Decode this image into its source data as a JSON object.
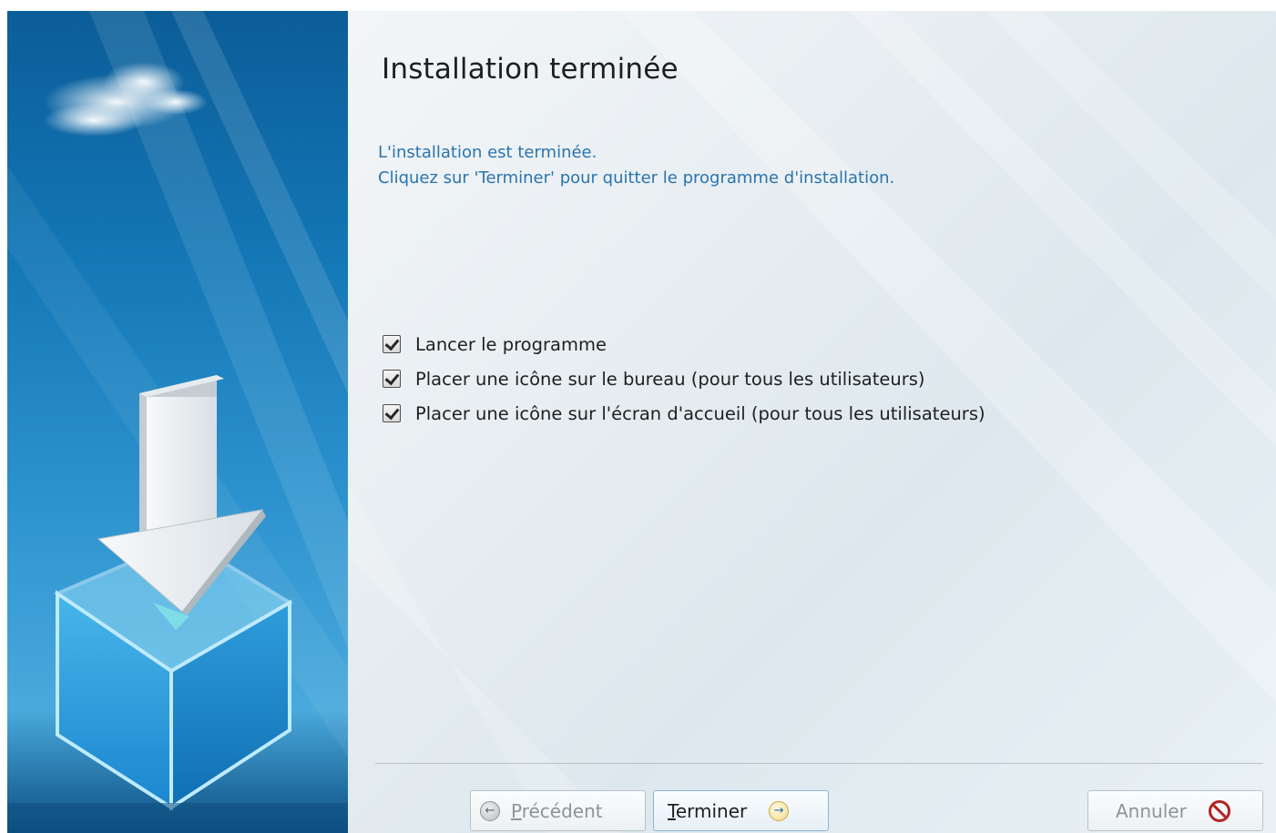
{
  "page": {
    "title": "Installation terminée",
    "message_line1": "L'installation est terminée.",
    "message_line2": "Cliquez sur 'Terminer' pour quitter le programme d'installation."
  },
  "options": [
    {
      "label": "Lancer le programme",
      "checked": true
    },
    {
      "label": "Placer une icône sur le bureau (pour tous les utilisateurs)",
      "checked": true
    },
    {
      "label": "Placer une icône sur l'écran d'accueil (pour tous les utilisateurs)",
      "checked": true
    }
  ],
  "buttons": {
    "previous": {
      "mnemonic": "P",
      "rest": "récédent",
      "enabled": false,
      "icon": "arrow-left-icon"
    },
    "finish": {
      "mnemonic": "T",
      "rest": "erminer",
      "enabled": true,
      "icon": "arrow-right-icon"
    },
    "cancel": {
      "label": "Annuler",
      "enabled": false,
      "icon": "cancel-icon"
    }
  },
  "colors": {
    "message_text": "#2a74ad",
    "banner_blue": "#1477b6",
    "cancel_red": "#b32323"
  }
}
